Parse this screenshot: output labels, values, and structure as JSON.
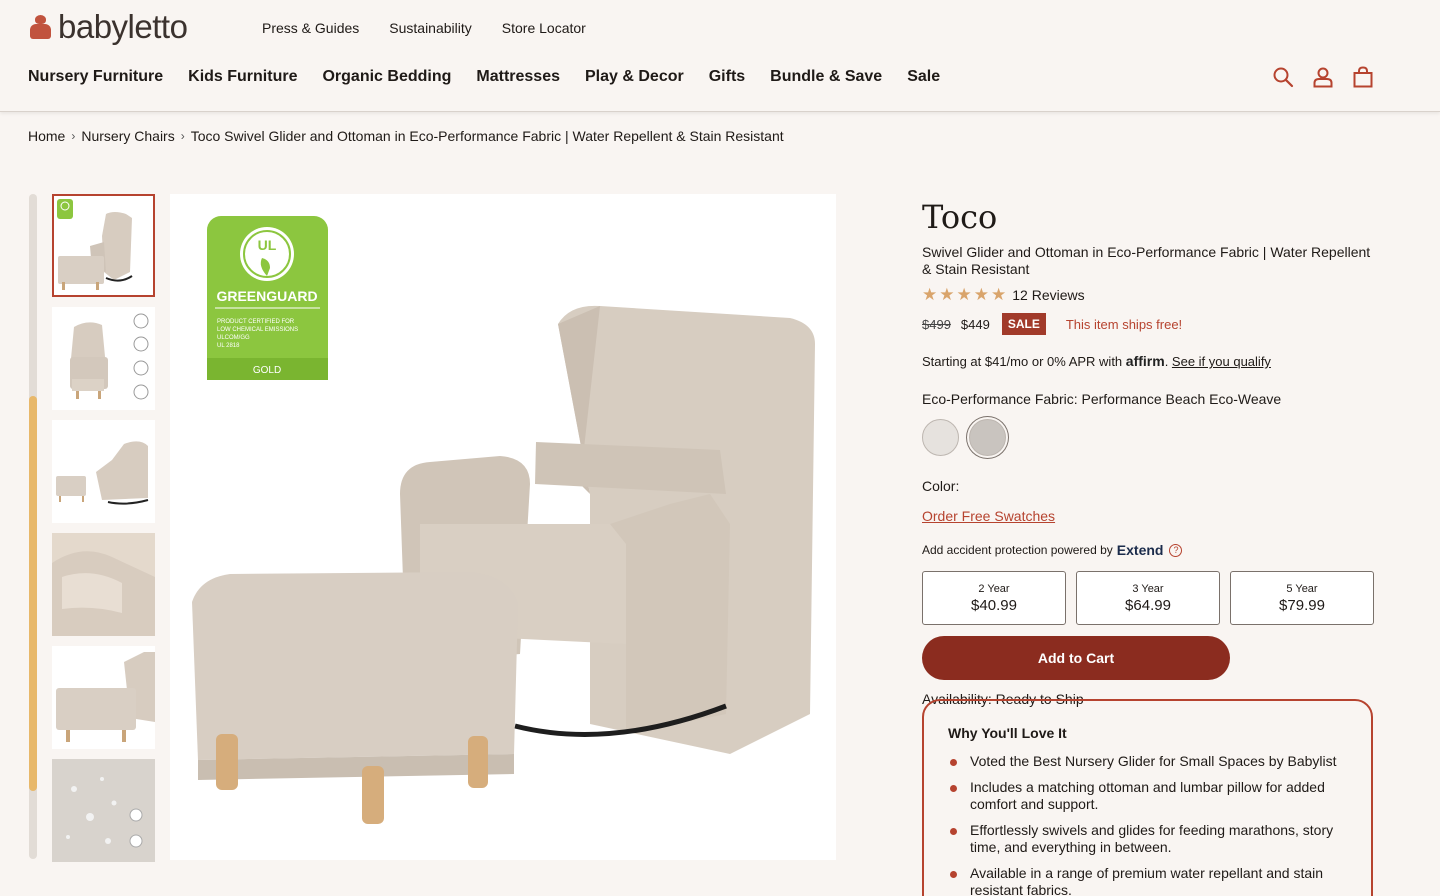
{
  "brand": {
    "name": "babyletto",
    "accent": "#b6432f"
  },
  "util_nav": [
    "Press & Guides",
    "Sustainability",
    "Store Locator"
  ],
  "main_nav": [
    "Nursery Furniture",
    "Kids Furniture",
    "Organic Bedding",
    "Mattresses",
    "Play & Decor",
    "Gifts",
    "Bundle & Save",
    "Sale"
  ],
  "header_icons": [
    "search-icon",
    "account-icon",
    "cart-icon"
  ],
  "breadcrumb": [
    "Home",
    "Nursery Chairs",
    "Toco Swivel Glider and Ottoman in Eco-Performance Fabric | Water Repellent & Stain Resistant"
  ],
  "gallery": {
    "thumbnail_count": 6,
    "badge": {
      "brand": "UL",
      "title": "GREENGUARD",
      "lines": [
        "PRODUCT CERTIFIED FOR",
        "LOW CHEMICAL EMISSIONS",
        "ULCOM/GG",
        "UL 2818"
      ],
      "level": "GOLD"
    }
  },
  "product": {
    "title": "Toco",
    "subtitle": "Swivel Glider and Ottoman in Eco-Performance Fabric | Water Repellent & Stain Resistant",
    "rating": 5,
    "reviews": "12 Reviews",
    "old_price": "$499",
    "price": "$449",
    "sale_badge": "SALE",
    "shipping": "This item ships free!",
    "affirm_prefix": "Starting at $41/mo or 0% APR with",
    "affirm_brand": "affirm",
    "affirm_link": "See if you qualify",
    "fabric_label": "Eco-Performance Fabric: Performance Beach Eco-Weave",
    "swatch_colors": [
      "#e6e2de",
      "#c9c4bf"
    ],
    "color_label": "Color:",
    "order_swatches": "Order Free Swatches",
    "extend_prefix": "Add accident protection powered by",
    "extend_brand": "Extend",
    "plans": [
      {
        "term": "2 Year",
        "price": "$40.99"
      },
      {
        "term": "3 Year",
        "price": "$64.99"
      },
      {
        "term": "5 Year",
        "price": "$79.99"
      }
    ],
    "add_to_cart": "Add to Cart",
    "availability": "Availability: Ready to Ship"
  },
  "why_love": {
    "title": "Why You'll Love It",
    "items": [
      "Voted the Best Nursery Glider for Small Spaces by Babylist",
      "Includes a matching ottoman and lumbar pillow for added comfort and support.",
      "Effortlessly swivels and glides for feeding marathons, story time, and everything in between.",
      "Available in a range of premium water repellant and stain resistant fabrics."
    ]
  }
}
